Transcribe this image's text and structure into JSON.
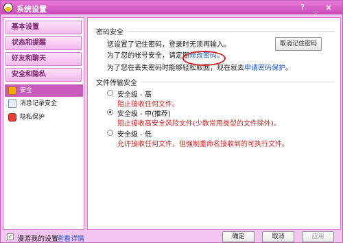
{
  "window": {
    "title": "系统设置",
    "help": "?",
    "minimize": "_",
    "close": "×"
  },
  "sidebar": {
    "categories": [
      "基本设置",
      "状态和提醒",
      "好友和聊天",
      "安全和隐私"
    ],
    "items": [
      "安全",
      "消息记录安全",
      "隐私保护"
    ]
  },
  "password": {
    "section_title": "密码安全",
    "line1": "您设置了记住密码，登录时无须再输入。",
    "line2_prefix": "为了您的帐号安全，请定期",
    "line2_link": "修改密码",
    "line2_suffix": "。",
    "line3_prefix": "为了您在丢失密码时能够轻松取回，现在就去",
    "line3_link": "申请密码保护",
    "line3_suffix": "。",
    "cancel_remember_button": "取消记住密码"
  },
  "file_transfer": {
    "section_title": "文件传输安全",
    "options": [
      {
        "title": "安全级 - 高",
        "desc": "阻止接收任何文件。",
        "selected": false
      },
      {
        "title": "安全级 - 中(推荐)",
        "desc": "阻止接收高安全风险文件(少数常用类型的文件除外)。",
        "selected": true
      },
      {
        "title": "安全级 - 低",
        "desc": "允许接收任何文件，但强制重命名接收到的可执行文件。",
        "selected": false
      }
    ]
  },
  "footer": {
    "roaming_label": "漫游我的设置",
    "details_link": "查看详情",
    "ok_button": "确定",
    "cancel_button": "取消",
    "apply_button": "应用"
  }
}
